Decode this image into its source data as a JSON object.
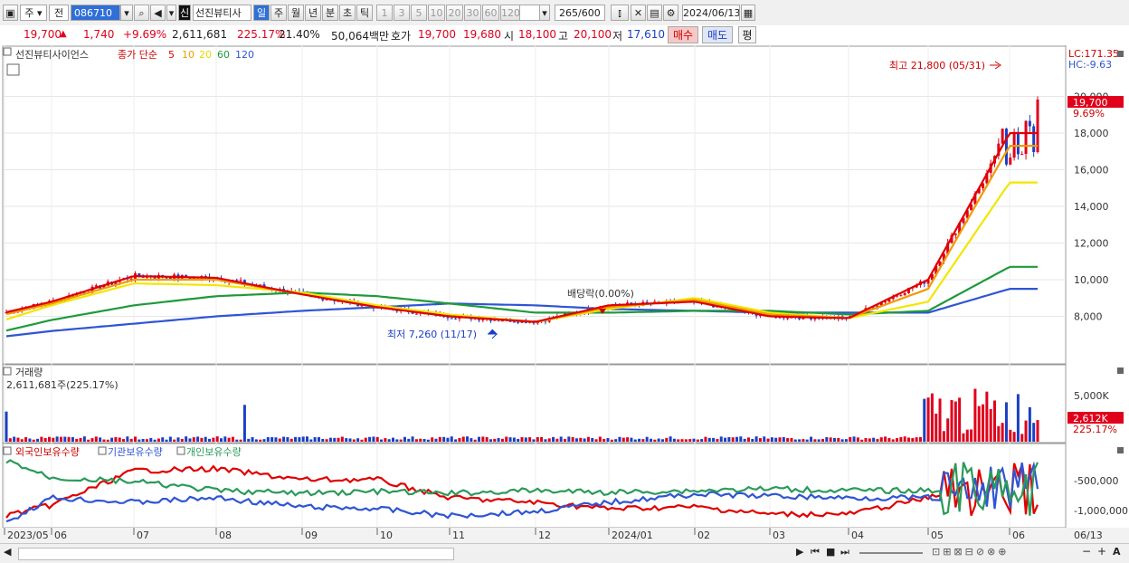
{
  "toolbar": {
    "market": "주",
    "prev": "전",
    "code": "086710",
    "badge": "신",
    "stock_name": "선진뷰티사",
    "periods": [
      "일",
      "주",
      "월",
      "년",
      "분",
      "초",
      "틱"
    ],
    "active_period": "일",
    "intervals": [
      "1",
      "3",
      "5",
      "10",
      "20",
      "30",
      "60",
      "120"
    ],
    "count": "265",
    "count_total": "/600",
    "date": "2024/06/13"
  },
  "quote": {
    "price": "19,700",
    "arrow": "▲",
    "change": "1,740",
    "change_pct": "+9.69%",
    "volume": "2,611,681",
    "vol_ratio": "225.17%",
    "turnover": "21.40%",
    "amount": "50,064백만",
    "hoga_label": "호가",
    "ask": "19,700",
    "bid": "19,680",
    "open_label": "시",
    "open": "18,100",
    "high_label": "고",
    "high": "20,100",
    "low_label": "저",
    "low": "17,610",
    "buy": "매수",
    "sell": "매도",
    "avg": "평"
  },
  "price_panel": {
    "name_tag": "선진뷰티사이언스",
    "ma_label": "종가 단순",
    "ma_periods": [
      "5",
      "10",
      "20",
      "60",
      "120"
    ],
    "lc": "LC:171.35",
    "hc": "HC:-9.63",
    "high_note": "최고 21,800 (05/31)",
    "low_note": "최저 7,260 (11/17)",
    "dividend_note": "배당락(0.00%)",
    "price_tag": "19,700",
    "pct_tag": "9.69%",
    "y_ticks": [
      "20,000",
      "18,000",
      "16,000",
      "14,000",
      "12,000",
      "10,000",
      "8,000"
    ]
  },
  "volume_panel": {
    "label": "거래량",
    "value": "2,611,681주(225.17%)",
    "y_tick": "5,000K",
    "tag": "2,612K",
    "tag_pct": "225.17%"
  },
  "holding_panel": {
    "labels": [
      "외국인보유수량",
      "기관보유수량",
      "개인보유수량"
    ],
    "y_ticks": [
      "-500,000",
      "-1,000,000"
    ]
  },
  "x_axis": [
    "2023/05",
    "06",
    "07",
    "08",
    "09",
    "10",
    "11",
    "12",
    "2024/01",
    "02",
    "03",
    "04",
    "05",
    "06"
  ],
  "x_axis_right": "06/13",
  "colors": {
    "up": "#e0001b",
    "down": "#1a3fc4",
    "ma5": "#e00000",
    "ma10": "#f09a00",
    "ma20": "#f2e600",
    "ma60": "#1e9a3a",
    "ma120": "#2f55d4",
    "foreign": "#e00000",
    "institution": "#2f55d4",
    "individual": "#2a9a5a"
  },
  "chart_data": {
    "type": "line",
    "x": [
      "2023/05",
      "06",
      "07",
      "08",
      "09",
      "10",
      "11",
      "12",
      "2024/01",
      "02",
      "03",
      "04",
      "05",
      "06"
    ],
    "series": [
      {
        "name": "5",
        "values": [
          8200,
          8800,
          10200,
          10100,
          9200,
          8500,
          8000,
          7700,
          8600,
          8800,
          8000,
          7900,
          10000,
          18000
        ]
      },
      {
        "name": "10",
        "values": [
          8100,
          8700,
          10000,
          10000,
          9200,
          8500,
          8000,
          7700,
          8500,
          8900,
          8100,
          7900,
          9500,
          17300
        ]
      },
      {
        "name": "20",
        "values": [
          7800,
          8600,
          9800,
          9700,
          9300,
          8600,
          8100,
          7700,
          8400,
          9000,
          8200,
          7900,
          8800,
          15300
        ]
      },
      {
        "name": "60",
        "values": [
          7200,
          7800,
          8600,
          9100,
          9300,
          9100,
          8700,
          8200,
          8200,
          8300,
          8300,
          8100,
          8300,
          10700
        ]
      },
      {
        "name": "120",
        "values": [
          6900,
          7200,
          7600,
          8000,
          8300,
          8500,
          8700,
          8600,
          8400,
          8300,
          8200,
          8200,
          8200,
          9500
        ]
      }
    ],
    "ylim": [
      7000,
      21800
    ]
  }
}
